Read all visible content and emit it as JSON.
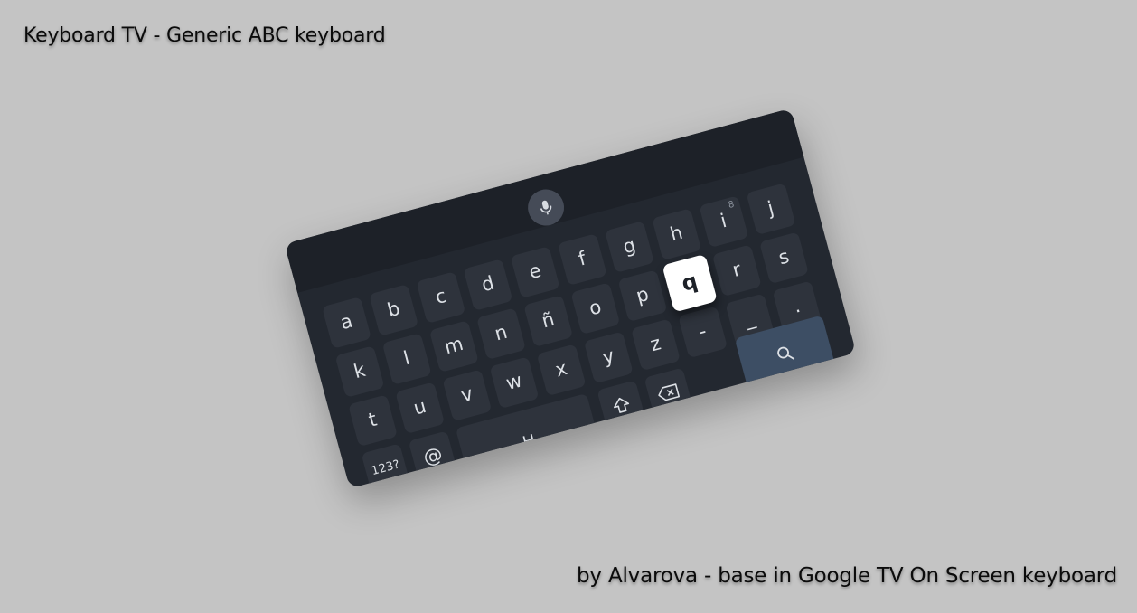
{
  "caption": {
    "title": "Keyboard TV - Generic ABC keyboard",
    "credit": "by Alvarova - base in Google TV On Screen keyboard"
  },
  "keyboard": {
    "focused_key": "q",
    "row1": [
      "a",
      "b",
      "c",
      "d",
      "e",
      "f",
      "g",
      "h",
      "i",
      "j"
    ],
    "row1_hint": {
      "i": "8"
    },
    "row2": [
      "k",
      "l",
      "m",
      "n",
      "ñ",
      "o",
      "p",
      "q",
      "r",
      "s"
    ],
    "row3": [
      "t",
      "u",
      "v",
      "w",
      "x",
      "y",
      "z",
      "-",
      "_",
      "."
    ],
    "row4": {
      "symbols_label": "123?",
      "at_label": "@",
      "space_label": "␣"
    },
    "icons": {
      "mic": "mic-icon",
      "shift": "shift-icon",
      "backspace": "backspace-icon",
      "search": "search-icon"
    },
    "colors": {
      "background": "#c4c4c4",
      "keyboard_body": "#232830",
      "key": "#2e333c",
      "focus_key": "#ffffff",
      "search_key": "#3d4e64",
      "mic_button": "#454b57"
    }
  }
}
